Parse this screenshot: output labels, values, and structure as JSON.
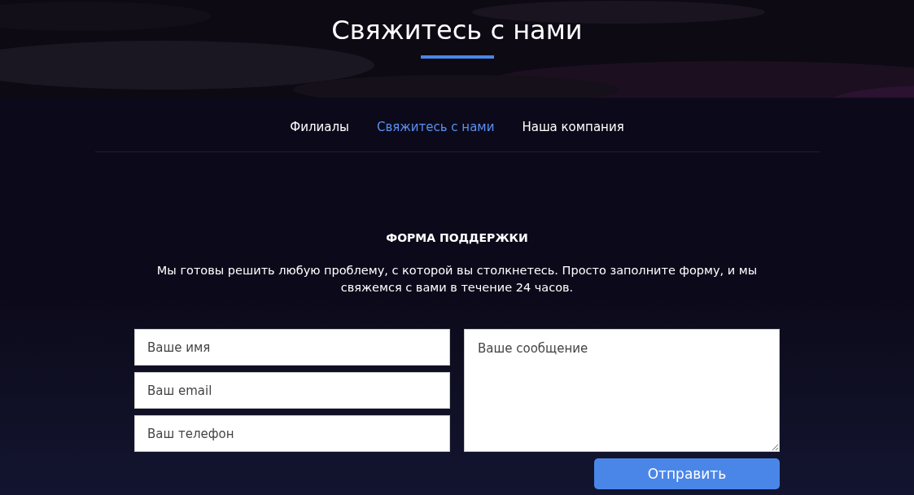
{
  "header": {
    "title": "Свяжитесь с нами"
  },
  "nav": [
    {
      "label": "Филиалы",
      "selected": false
    },
    {
      "label": "Свяжитесь с нами",
      "selected": true
    },
    {
      "label": "Наша компания",
      "selected": false
    }
  ],
  "form": {
    "title": "ФОРМА ПОДДЕРЖКИ",
    "description": "Мы готовы решить любую проблему, с которой вы столкнетесь. Просто заполните форму, и мы свяжемся с вами в течение 24 часов.",
    "fields": [
      {
        "placeholder": "Ваше имя"
      },
      {
        "placeholder": "Ваш email"
      },
      {
        "placeholder": "Ваш телефон"
      }
    ],
    "message": {
      "placeholder": "Ваше сообщение"
    },
    "submit": "Отправить"
  }
}
